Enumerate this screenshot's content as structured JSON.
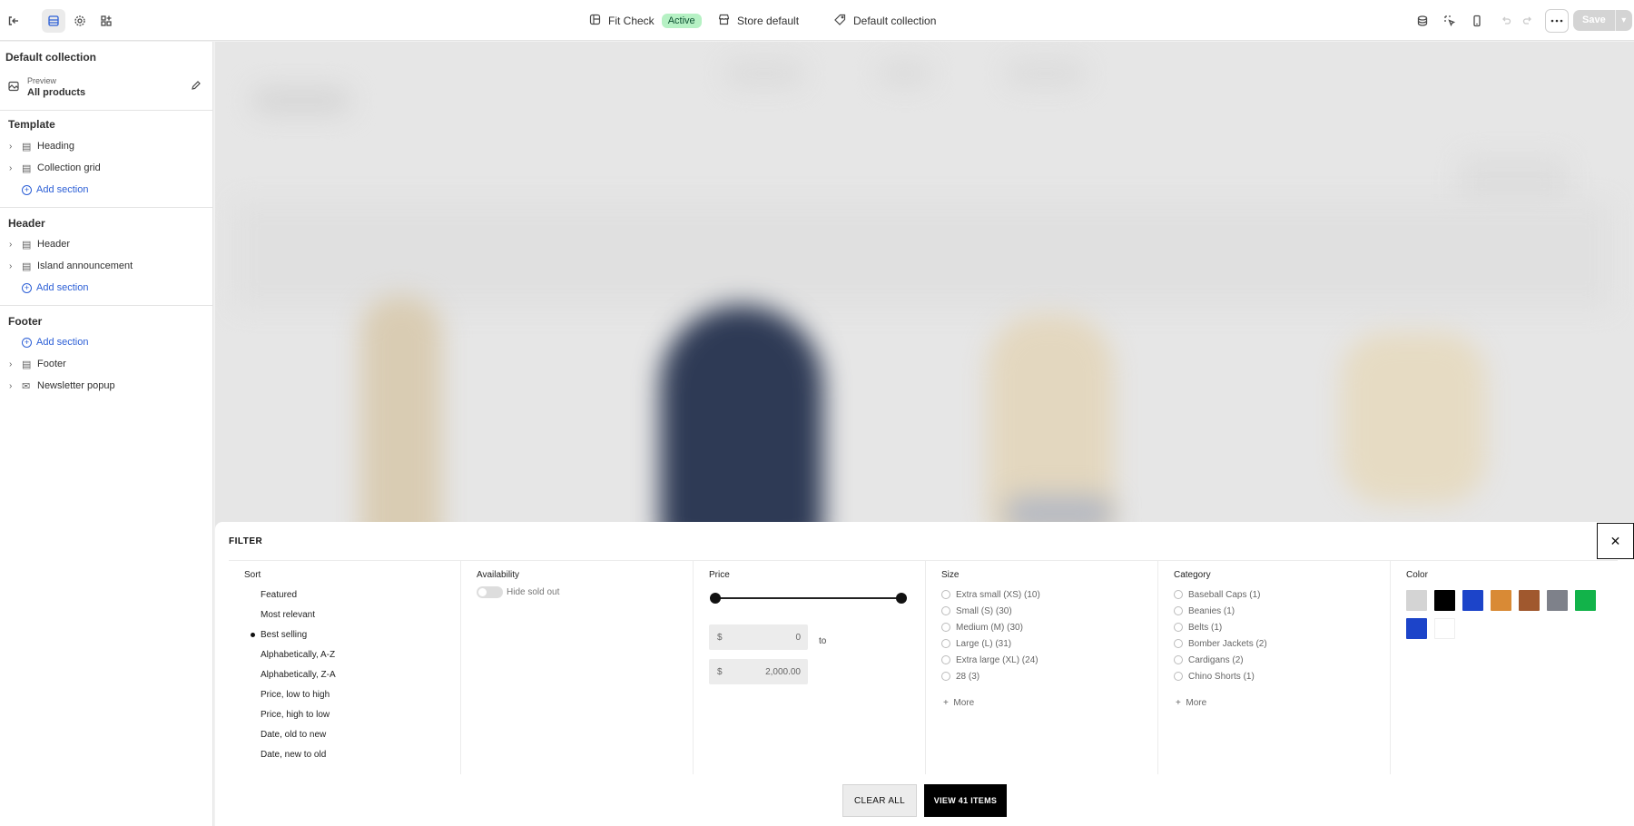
{
  "topbar": {
    "theme_name": "Fit Check",
    "theme_status": "Active",
    "store": "Store default",
    "template": "Default collection",
    "save_label": "Save",
    "icons": [
      "exit-icon",
      "sections-icon",
      "settings-icon",
      "apps-icon",
      "inspector-icon",
      "select-icon",
      "mobile-icon",
      "undo-icon",
      "redo-icon",
      "more-icon"
    ]
  },
  "sidebar": {
    "title": "Default collection",
    "preview_label": "Preview",
    "preview_value": "All products",
    "template_title": "Template",
    "template_items": [
      "Heading",
      "Collection grid"
    ],
    "add_section": "Add section",
    "header_title": "Header",
    "header_items": [
      "Header",
      "Island announcement"
    ],
    "footer_title": "Footer",
    "footer_items": [
      "Footer",
      "Newsletter popup"
    ]
  },
  "filter": {
    "title": "FILTER",
    "sort_head": "Sort",
    "sort_options": [
      "Featured",
      "Most relevant",
      "Best selling",
      "Alphabetically, A-Z",
      "Alphabetically, Z-A",
      "Price, low to high",
      "Price, high to low",
      "Date, old to new",
      "Date, new to old"
    ],
    "sort_selected": "Best selling",
    "availability_head": "Availability",
    "availability_toggle": "Hide sold out",
    "price_head": "Price",
    "currency": "$",
    "price_min": "0",
    "price_max": "2,000.00",
    "price_to": "to",
    "size_head": "Size",
    "sizes": [
      "Extra small (XS) (10)",
      "Small (S) (30)",
      "Medium (M) (30)",
      "Large (L) (31)",
      "Extra large (XL) (24)",
      "28 (3)"
    ],
    "category_head": "Category",
    "categories": [
      "Baseball Caps (1)",
      "Beanies (1)",
      "Belts (1)",
      "Bomber Jackets (2)",
      "Cardigans (2)",
      "Chino Shorts (1)"
    ],
    "more": "More",
    "color_head": "Color",
    "colors": [
      "#d4d4d4",
      "#000000",
      "#1c44c9",
      "#d98a35",
      "#a0582e",
      "#7e818a",
      "#12b34a",
      "#1c44c9",
      "#ffffff"
    ],
    "clear_all": "CLEAR ALL",
    "view_items": "VIEW 41 ITEMS"
  }
}
